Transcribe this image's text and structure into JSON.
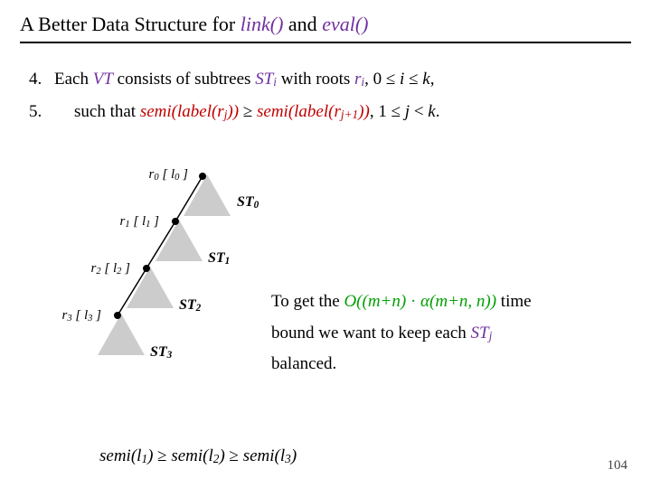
{
  "title": {
    "pre": "A Better Data Structure for ",
    "fn1": "link()",
    "mid": " and ",
    "fn2": "eval()"
  },
  "bullets": {
    "n4": "4.",
    "b4": {
      "a": "Each ",
      "b": "VT",
      "c": " consists of subtrees ",
      "d": "ST",
      "dsub": "i",
      "e": " with roots ",
      "f": "r",
      "fsub": "i",
      "g": ", 0 ≤ ",
      "h": "i",
      "i": " ≤ ",
      "j": "k",
      "k": ","
    },
    "n5": "5.",
    "b5": {
      "a": "such that ",
      "b": "semi(label(r",
      "bsub": "j",
      "c": "))",
      "d": " ≥ ",
      "e": "semi(label(r",
      "esub": "j+1",
      "f": "))",
      "g": ", 1 ≤ ",
      "h": "j",
      "i": " < ",
      "j": "k",
      "k": "."
    }
  },
  "stage": {
    "r0": "r",
    "r0sub": "0",
    "l0": "l",
    "l0sub": "0",
    "r1": "r",
    "r1sub": "1",
    "l1": "l",
    "l1sub": "1",
    "r2": "r",
    "r2sub": "2",
    "l2": "l",
    "l2sub": "2",
    "r3": "r",
    "r3sub": "3",
    "l3": "l",
    "l3sub": "3",
    "ST0": "ST",
    "ST0sub": "0",
    "ST1": "ST",
    "ST1sub": "1",
    "ST2": "ST",
    "ST2sub": "2",
    "ST3": "ST",
    "ST3sub": "3"
  },
  "commentary": {
    "p1a": "To get the ",
    "p1b": "O((m+n)",
    "p1c": " · ",
    "p1d": "α",
    "p1e": "(m+n, n))",
    "p1f": " time",
    "p2a": "bound we want to keep each ",
    "p2b": "ST",
    "p2bsub": "j",
    "p3": "balanced."
  },
  "bottom": {
    "a": "semi(l",
    "asub": "1",
    "b": ")",
    "c": " ≥ ",
    "d": "semi(l",
    "dsub": "2",
    "e": ")",
    "f": " ≥ ",
    "g": "semi(l",
    "gsub": "3",
    "h": ")"
  },
  "page": "104"
}
